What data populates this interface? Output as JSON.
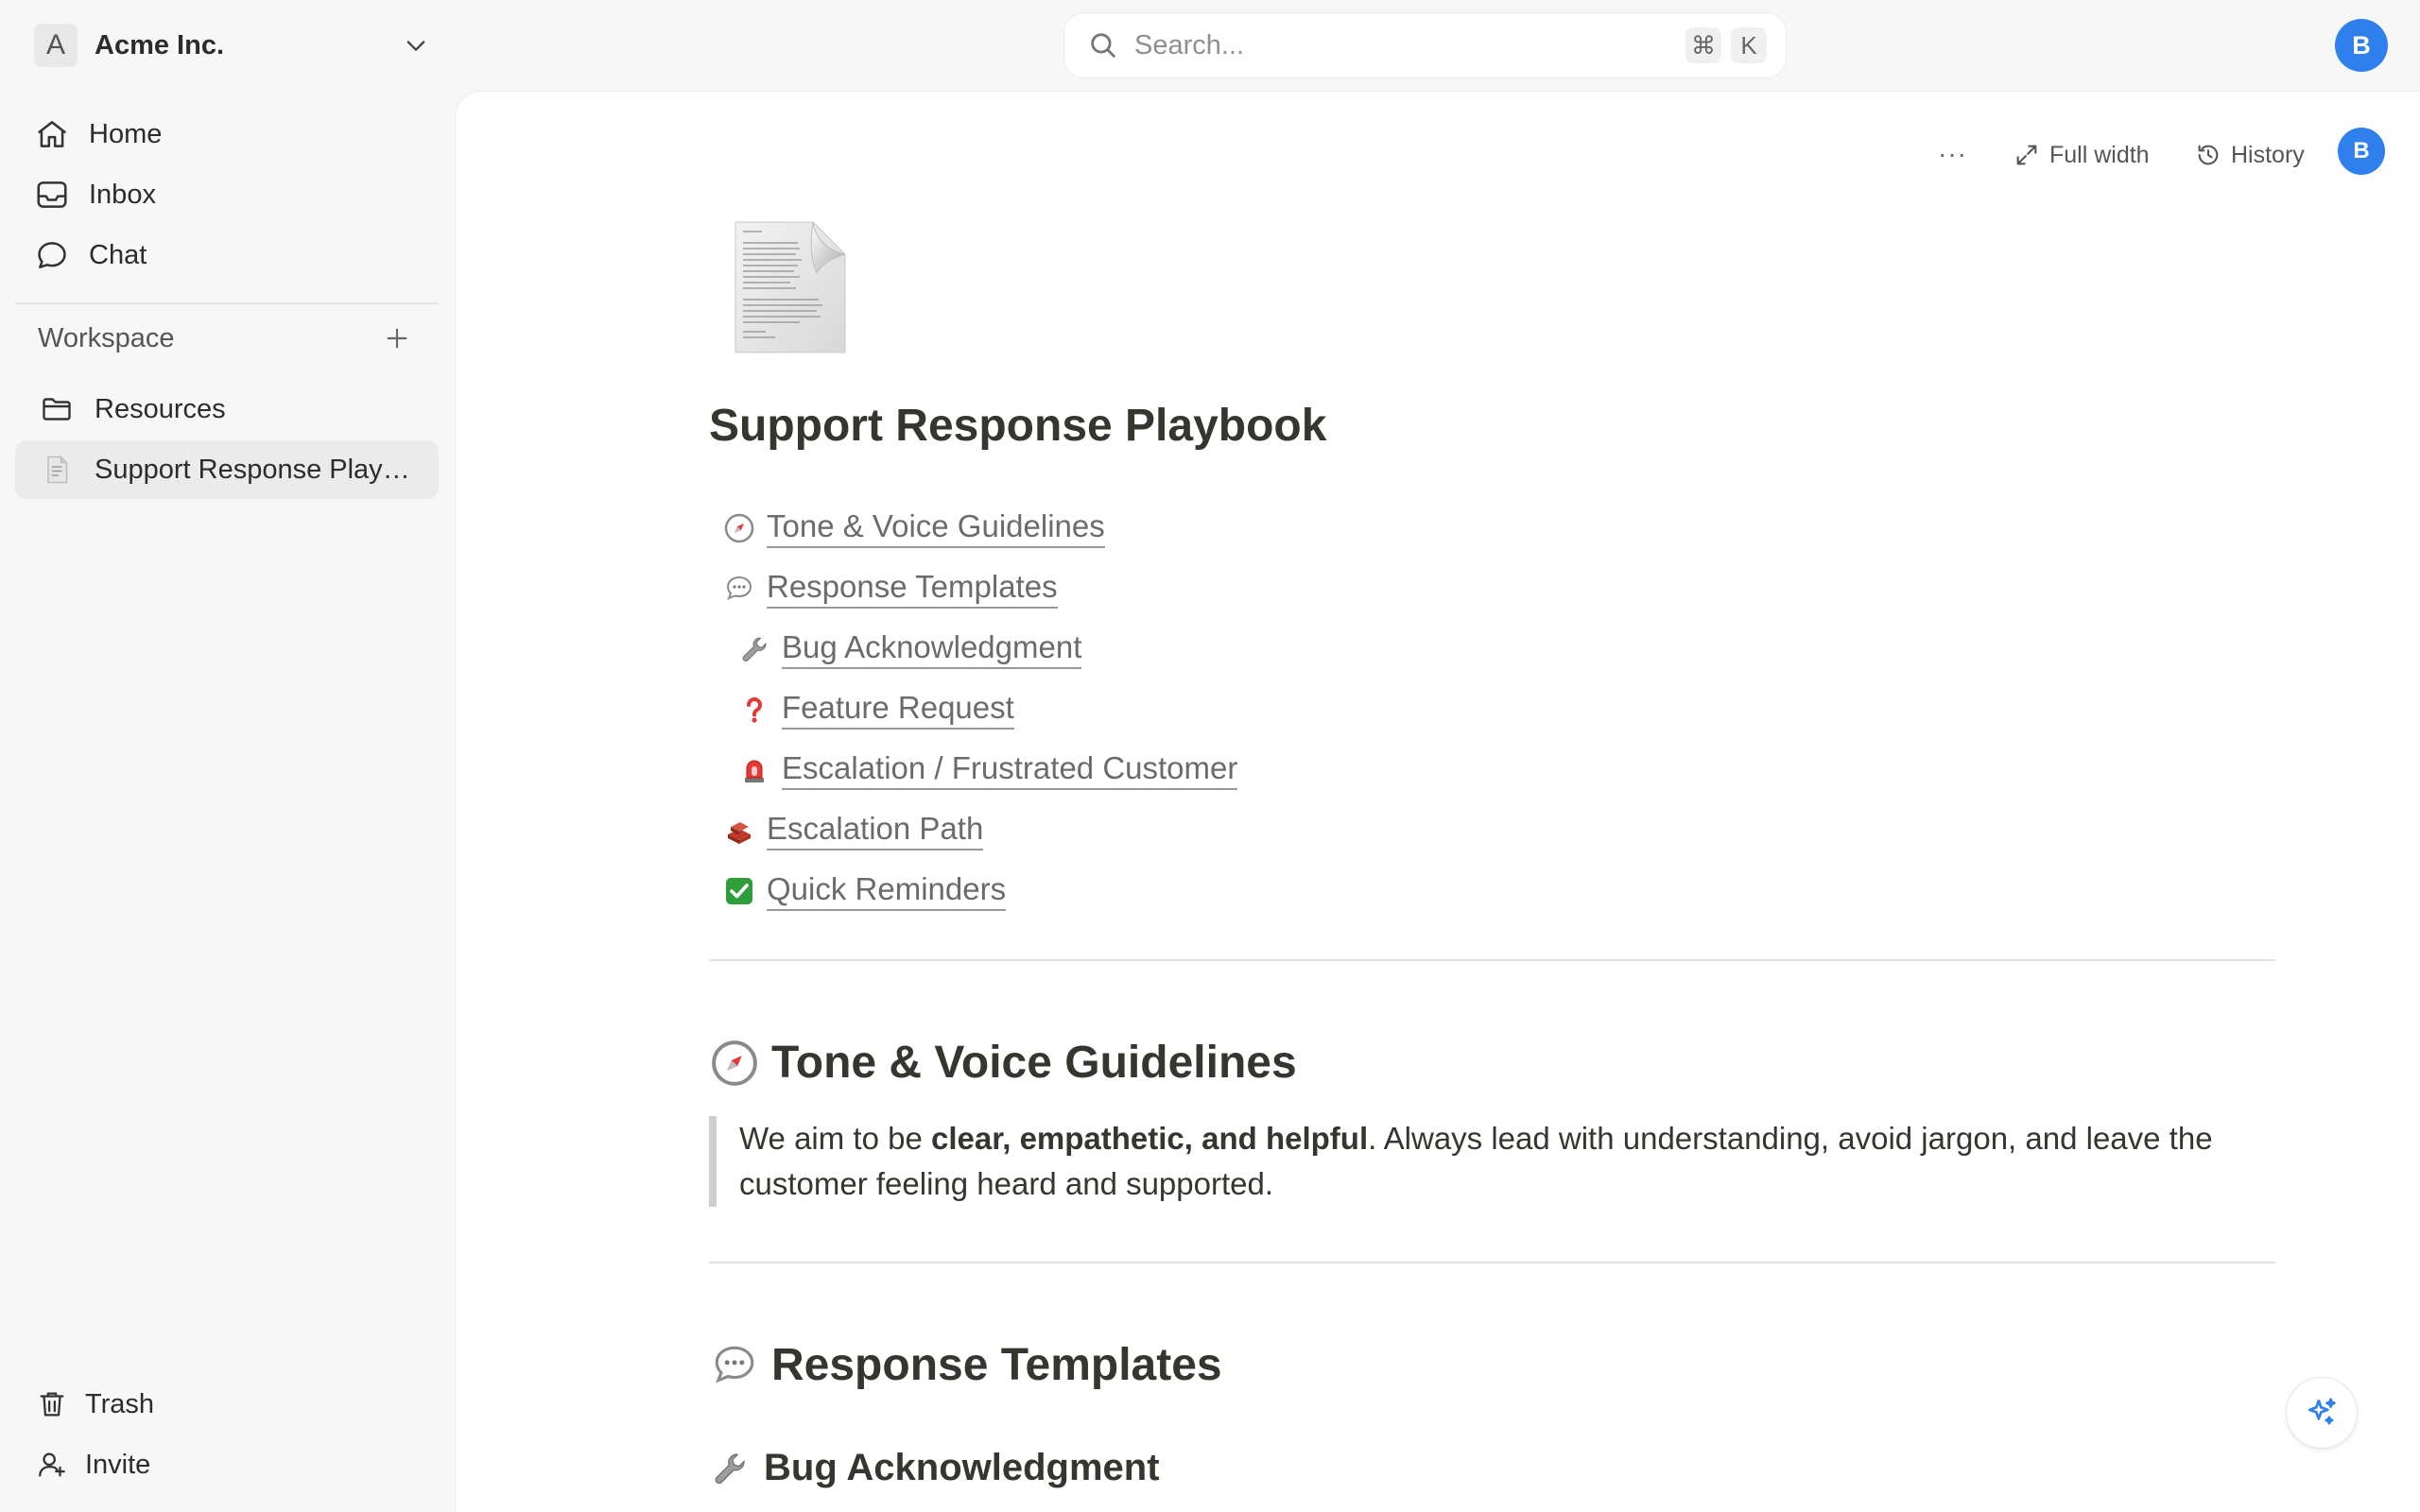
{
  "workspace": {
    "initial": "A",
    "name": "Acme Inc."
  },
  "search": {
    "placeholder": "Search...",
    "shortcut_mod": "⌘",
    "shortcut_key": "K"
  },
  "user": {
    "initial": "B"
  },
  "sidebar": {
    "nav": [
      {
        "label": "Home",
        "icon": "home-icon"
      },
      {
        "label": "Inbox",
        "icon": "inbox-icon"
      },
      {
        "label": "Chat",
        "icon": "chat-icon"
      }
    ],
    "section_label": "Workspace",
    "tree": [
      {
        "label": "Resources",
        "icon": "folder-icon",
        "active": false
      },
      {
        "label": "Support Response Playbook",
        "icon": "document-icon",
        "active": true
      }
    ],
    "bottom": [
      {
        "label": "Trash",
        "icon": "trash-icon"
      },
      {
        "label": "Invite",
        "icon": "invite-user-icon"
      }
    ]
  },
  "toolbar": {
    "more": "···",
    "full_width": "Full width",
    "history": "History",
    "avatar": "B"
  },
  "page": {
    "title": "Support Response Playbook",
    "toc": [
      {
        "emoji": "🧭",
        "label": "Tone & Voice Guidelines",
        "level": 1
      },
      {
        "emoji": "💬",
        "label": "Response Templates",
        "level": 1
      },
      {
        "emoji": "🔧",
        "label": "Bug Acknowledgment",
        "level": 2
      },
      {
        "emoji": "❓",
        "label": "Feature Request",
        "level": 2
      },
      {
        "emoji": "🚨",
        "label": "Escalation / Frustrated Customer",
        "level": 2
      },
      {
        "emoji": "🧱",
        "label": "Escalation Path",
        "level": 1
      },
      {
        "emoji": "✅",
        "label": "Quick Reminders",
        "level": 1
      }
    ],
    "section_tone": {
      "emoji": "🧭",
      "heading": "Tone & Voice Guidelines",
      "quote_before": "We aim to be ",
      "quote_bold": "clear, empathetic, and helpful",
      "quote_after": ". Always lead with understanding, avoid jargon, and leave the customer feeling heard and supported."
    },
    "section_templates": {
      "emoji": "💬",
      "heading": "Response Templates"
    },
    "subsection_bug": {
      "emoji": "🔧",
      "heading": "Bug Acknowledgment"
    }
  },
  "colors": {
    "accent": "#2f80ed",
    "sidebar_bg": "#f7f7f7",
    "main_bg": "#ffffff"
  }
}
